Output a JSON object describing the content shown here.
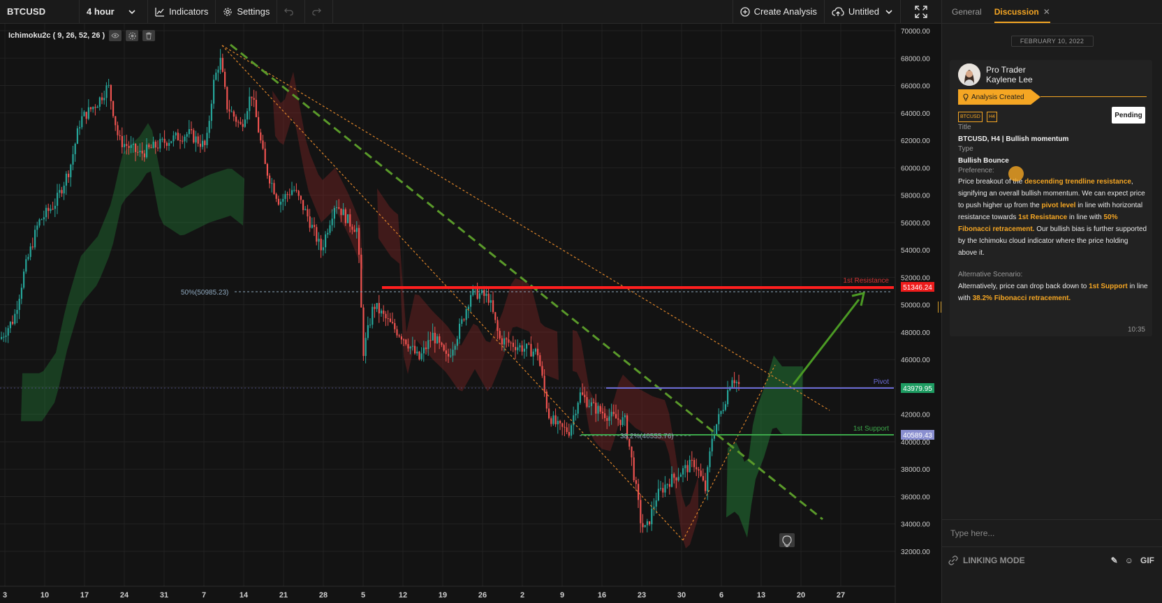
{
  "toolbar": {
    "symbol": "BTCUSD",
    "interval": "4 hour",
    "indicators_label": "Indicators",
    "settings_label": "Settings",
    "create_analysis_label": "Create Analysis",
    "layout_name": "Untitled"
  },
  "chart": {
    "indicator_label": "Ichimoku2c ( 9, 26, 52, 26 )",
    "colors": {
      "up": "#26a69a",
      "down": "#ef5350",
      "resistance": "#ff1f1f",
      "pivot": "#6b6bd6",
      "support": "#3ca84a",
      "trendline": "#5a9a2a",
      "channel": "#e0862a"
    },
    "price_axis": [
      "70000.00",
      "68000.00",
      "66000.00",
      "64000.00",
      "62000.00",
      "60000.00",
      "58000.00",
      "56000.00",
      "54000.00",
      "52000.00",
      "50000.00",
      "48000.00",
      "46000.00",
      "44000.00",
      "42000.00",
      "40000.00",
      "38000.00",
      "36000.00",
      "34000.00",
      "32000.00"
    ],
    "time_axis": [
      "3",
      "10",
      "17",
      "24",
      "31",
      "7",
      "14",
      "21",
      "28",
      "5",
      "12",
      "19",
      "26",
      "2",
      "9",
      "16",
      "23",
      "30",
      "6",
      "13",
      "20",
      "27"
    ],
    "levels": {
      "resistance": {
        "label": "1st Resistance",
        "price_tag": "51346.24"
      },
      "pivot": {
        "label": "Pivot",
        "price_tag": "43979.95"
      },
      "support": {
        "label": "1st Support",
        "price_tag": "40589.43"
      },
      "fib50": {
        "label": "50%(50985.23)"
      },
      "fib382": {
        "label": "38.2%(40555.76)"
      }
    }
  },
  "panel": {
    "tabs": [
      {
        "label": "General"
      },
      {
        "label": "Discussion"
      }
    ],
    "date": "FEBRUARY 10, 2022",
    "author": {
      "line1": "Pro Trader",
      "line2": "Kaylene Lee"
    },
    "status_flag": "Analysis Created",
    "tags": [
      "BTCUSD",
      "H4"
    ],
    "status_button": "Pending",
    "title_label": "Title",
    "title_value": "BTCUSD, H4 | Bullish momentum",
    "type_label": "Type",
    "type_value": "Bullish Bounce",
    "preference_label": "Preference:",
    "preference": {
      "t1": "Price breakout of the ",
      "h1": "descending trendline resistance",
      "t2": ", signifying an overall bullish momentum. We can expect price to push higher up from the ",
      "h2": "pivot level",
      "t3": " in line with horizontal resistance towards ",
      "h3": "1st Resistance",
      "t4": " in line with ",
      "h4": "50% Fibonacci retracement.",
      "t5": " Our bullish bias is further supported by the Ichimoku cloud indicator where the price holding above it."
    },
    "alternative_label": "Alternative Scenario:",
    "alternative": {
      "t1": "Alternatively, price can drop back down to ",
      "h1": "1st Support",
      "t2": " in line with ",
      "h2": "38.2% Fibonacci retracement."
    },
    "time": "10:35",
    "composer_placeholder": "Type here...",
    "linking_mode": "LINKING MODE",
    "gif_label": "GIF"
  }
}
